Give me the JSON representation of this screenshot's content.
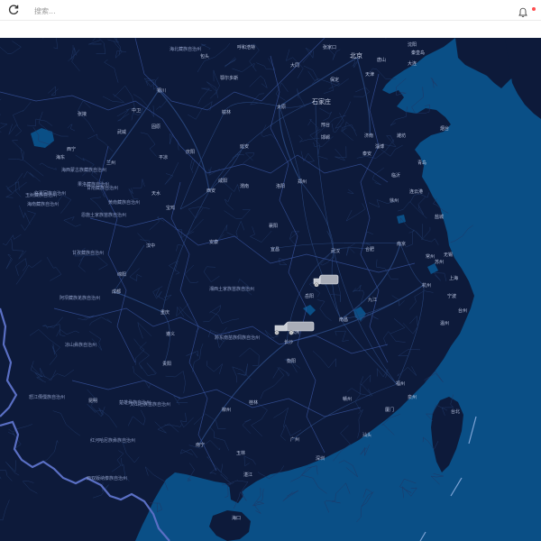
{
  "toolbar": {
    "refresh_icon": "refresh-icon",
    "search_placeholder": "搜索...",
    "notification_icon": "bell-icon",
    "notification_dot_color": "#ff4d4f"
  },
  "map": {
    "land_color": "#0d1a3a",
    "sea_color": "#0a4f86",
    "road_color": "#2b4a83",
    "border_color": "#5a6fc4",
    "cities": [
      {
        "name": "北京",
        "big": true
      },
      {
        "name": "天津"
      },
      {
        "name": "石家庄",
        "big": true
      },
      {
        "name": "太原"
      },
      {
        "name": "济南"
      },
      {
        "name": "郑州"
      },
      {
        "name": "西安"
      },
      {
        "name": "兰州"
      },
      {
        "name": "西宁"
      },
      {
        "name": "银川"
      },
      {
        "name": "呼和浩特"
      },
      {
        "name": "武汉"
      },
      {
        "name": "合肥"
      },
      {
        "name": "南京"
      },
      {
        "name": "上海"
      },
      {
        "name": "杭州"
      },
      {
        "name": "南昌"
      },
      {
        "name": "长沙"
      },
      {
        "name": "福州"
      },
      {
        "name": "广州"
      },
      {
        "name": "南宁"
      },
      {
        "name": "贵阳"
      },
      {
        "name": "重庆"
      },
      {
        "name": "成都"
      },
      {
        "name": "昆明"
      },
      {
        "name": "海口"
      },
      {
        "name": "台北"
      },
      {
        "name": "青岛"
      },
      {
        "name": "大连"
      },
      {
        "name": "沈阳"
      },
      {
        "name": "宁波"
      },
      {
        "name": "厦门"
      },
      {
        "name": "深圳"
      },
      {
        "name": "苏州"
      },
      {
        "name": "徐州"
      },
      {
        "name": "洛阳"
      },
      {
        "name": "宜昌"
      },
      {
        "name": "九江"
      },
      {
        "name": "赣州"
      },
      {
        "name": "桂林"
      },
      {
        "name": "遵义"
      },
      {
        "name": "绵阳"
      },
      {
        "name": "天水"
      },
      {
        "name": "宝鸡"
      },
      {
        "name": "汉中"
      },
      {
        "name": "安康"
      },
      {
        "name": "襄阳"
      },
      {
        "name": "岳阳"
      },
      {
        "name": "株洲"
      },
      {
        "name": "衡阳"
      },
      {
        "name": "柳州"
      },
      {
        "name": "玉林"
      },
      {
        "name": "湛江"
      },
      {
        "name": "汕头"
      },
      {
        "name": "泉州"
      },
      {
        "name": "温州"
      },
      {
        "name": "台州"
      },
      {
        "name": "无锡"
      },
      {
        "name": "常州"
      },
      {
        "name": "连云港"
      },
      {
        "name": "盐城"
      },
      {
        "name": "临沂"
      },
      {
        "name": "潍坊"
      },
      {
        "name": "烟台"
      },
      {
        "name": "淄博"
      },
      {
        "name": "泰安"
      },
      {
        "name": "邯郸"
      },
      {
        "name": "邢台"
      },
      {
        "name": "保定"
      },
      {
        "name": "唐山"
      },
      {
        "name": "秦皇岛"
      },
      {
        "name": "张家口"
      },
      {
        "name": "大同"
      },
      {
        "name": "包头"
      },
      {
        "name": "鄂尔多斯"
      },
      {
        "name": "榆林"
      },
      {
        "name": "延安"
      },
      {
        "name": "咸阳"
      },
      {
        "name": "渭南"
      },
      {
        "name": "平凉"
      },
      {
        "name": "庆阳"
      },
      {
        "name": "固原"
      },
      {
        "name": "中卫"
      },
      {
        "name": "武威"
      },
      {
        "name": "张掖"
      },
      {
        "name": "海东"
      },
      {
        "name": "玉树藏族自治州"
      },
      {
        "name": "海西蒙古族藏族自治州"
      },
      {
        "name": "果洛藏族自治州"
      },
      {
        "name": "甘孜藏族自治州"
      },
      {
        "name": "阿坝藏族羌族自治州"
      },
      {
        "name": "凉山彝族自治州"
      },
      {
        "name": "怒江傈僳族自治州"
      },
      {
        "name": "楚雄彝族自治州"
      },
      {
        "name": "红河哈尼族彝族自治州"
      },
      {
        "name": "西双版纳傣族自治州"
      },
      {
        "name": "文山壮族苗族自治州"
      },
      {
        "name": "黔东南苗族侗族自治州"
      },
      {
        "name": "湘西土家族苗族自治州"
      },
      {
        "name": "恩施土家族苗族自治州"
      },
      {
        "name": "甘南藏族自治州"
      },
      {
        "name": "临夏回族自治州"
      },
      {
        "name": "海南藏族自治州"
      },
      {
        "name": "黄南藏族自治州"
      },
      {
        "name": "海北藏族自治州"
      },
      {
        "name": "阿拉善盟"
      }
    ],
    "vehicles": [
      {
        "id": "truck-1"
      },
      {
        "id": "truck-2"
      }
    ]
  }
}
